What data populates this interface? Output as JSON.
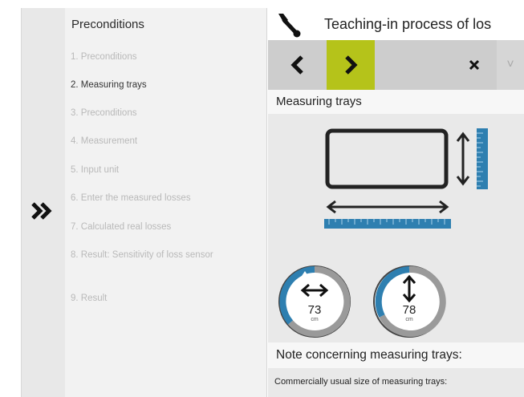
{
  "sidebar": {
    "collapse_icon": "double-chevron-right-icon",
    "heading": "Preconditions",
    "steps": [
      {
        "label": "1. Preconditions",
        "state": "inactive"
      },
      {
        "label": "2. Measuring trays",
        "state": "active"
      },
      {
        "label": "3. Preconditions",
        "state": "inactive"
      },
      {
        "label": "4. Measurement",
        "state": "inactive"
      },
      {
        "label": "5. Input unit",
        "state": "inactive"
      },
      {
        "label": "6. Enter the measured losses",
        "state": "inactive"
      },
      {
        "label": "7. Calculated real losses",
        "state": "inactive"
      },
      {
        "label": "8. Result: Sensitivity of loss sensor",
        "state": "inactive"
      },
      {
        "label": "9.  Result",
        "state": "inactive"
      }
    ]
  },
  "header": {
    "icon": "wrench-icon",
    "title": "Teaching-in process of los"
  },
  "toolbar": {
    "back_icon": "chevron-left-icon",
    "next_icon": "chevron-right-icon",
    "close_icon": "close-icon",
    "more_label": "˅",
    "accent_color": "#b5c31a"
  },
  "measuring": {
    "heading": "Measuring trays",
    "width": {
      "value": "73",
      "unit": "cm",
      "icon": "horizontal-arrows-icon"
    },
    "height": {
      "value": "78",
      "unit": "cm",
      "icon": "vertical-arrows-icon"
    },
    "ring_color": "#2e7fb0"
  },
  "note": {
    "heading": "Note concerning measuring trays:",
    "text": "Commercially usual size of measuring trays:"
  }
}
